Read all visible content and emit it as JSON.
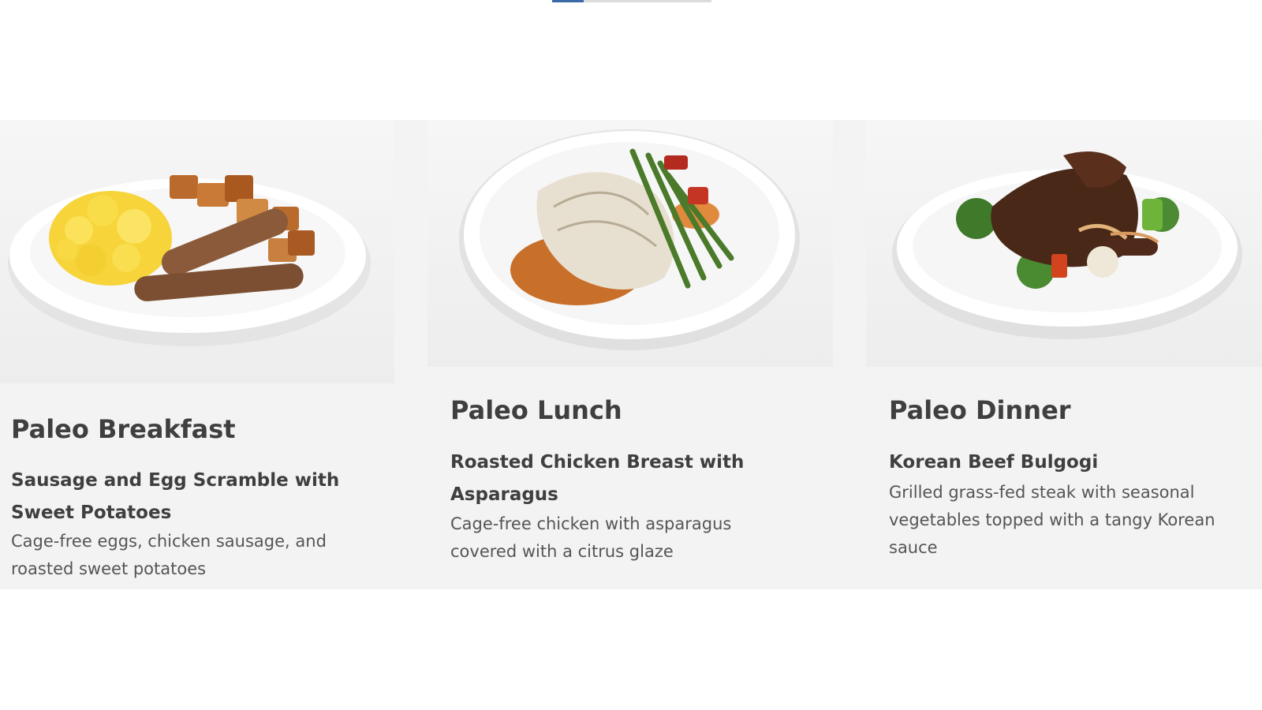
{
  "carousel": {
    "indicator": "slide-1"
  },
  "cards": [
    {
      "title": "Paleo Breakfast",
      "dish": "Sausage and Egg Scramble with Sweet Potatoes",
      "description": "Cage-free eggs, chicken sausage, and roasted sweet potatoes",
      "image_icon": "breakfast-plate-photo"
    },
    {
      "title": "Paleo Lunch",
      "dish": "Roasted Chicken Breast with Asparagus",
      "description": "Cage-free chicken with asparagus covered with a citrus glaze",
      "image_icon": "lunch-plate-photo"
    },
    {
      "title": "Paleo Dinner",
      "dish": "Korean Beef Bulgogi",
      "description": "Grilled grass-fed steak with seasonal vegetables topped with a tangy Korean sauce",
      "image_icon": "dinner-plate-photo"
    }
  ],
  "colors": {
    "card_background": "#f3f3f3",
    "heading_text": "#3f3f3f",
    "body_text": "#555555",
    "indicator_active": "#3b6aa8"
  }
}
